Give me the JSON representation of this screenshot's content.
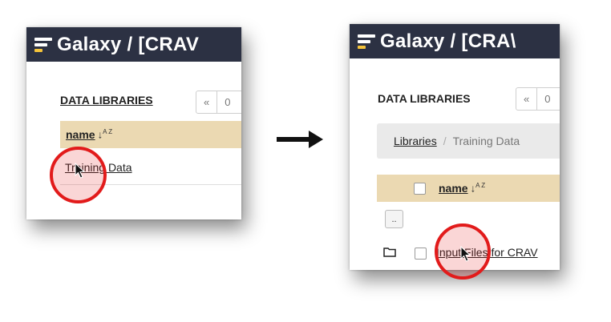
{
  "left": {
    "header": {
      "title": "Galaxy / [CRAV"
    },
    "section_title": "DATA LIBRARIES",
    "pager": {
      "prev": "«",
      "page": "0"
    },
    "table": {
      "column_header": "name",
      "sort_icon": "↓",
      "sort_icon_sub": "A Z",
      "rows": [
        {
          "name": "Training Data"
        }
      ]
    }
  },
  "right": {
    "header": {
      "title": "Galaxy / [CRA\\"
    },
    "section_title": "DATA LIBRARIES",
    "pager": {
      "prev": "«",
      "page": "0"
    },
    "breadcrumb": {
      "root": "Libraries",
      "separator": "/",
      "current": "Training Data"
    },
    "table": {
      "column_header": "name",
      "sort_icon": "↓",
      "sort_icon_sub": "A Z",
      "up_button": "..",
      "rows": [
        {
          "name": "Input Files for CRAV"
        }
      ]
    }
  },
  "annotations": {
    "highlight_color": "#e21b1b",
    "arrow_color": "#111111"
  },
  "colors": {
    "header_bg": "#2c3143",
    "table_header_bg": "#ebd9b2",
    "breadcrumb_bg": "#eaeaea"
  }
}
